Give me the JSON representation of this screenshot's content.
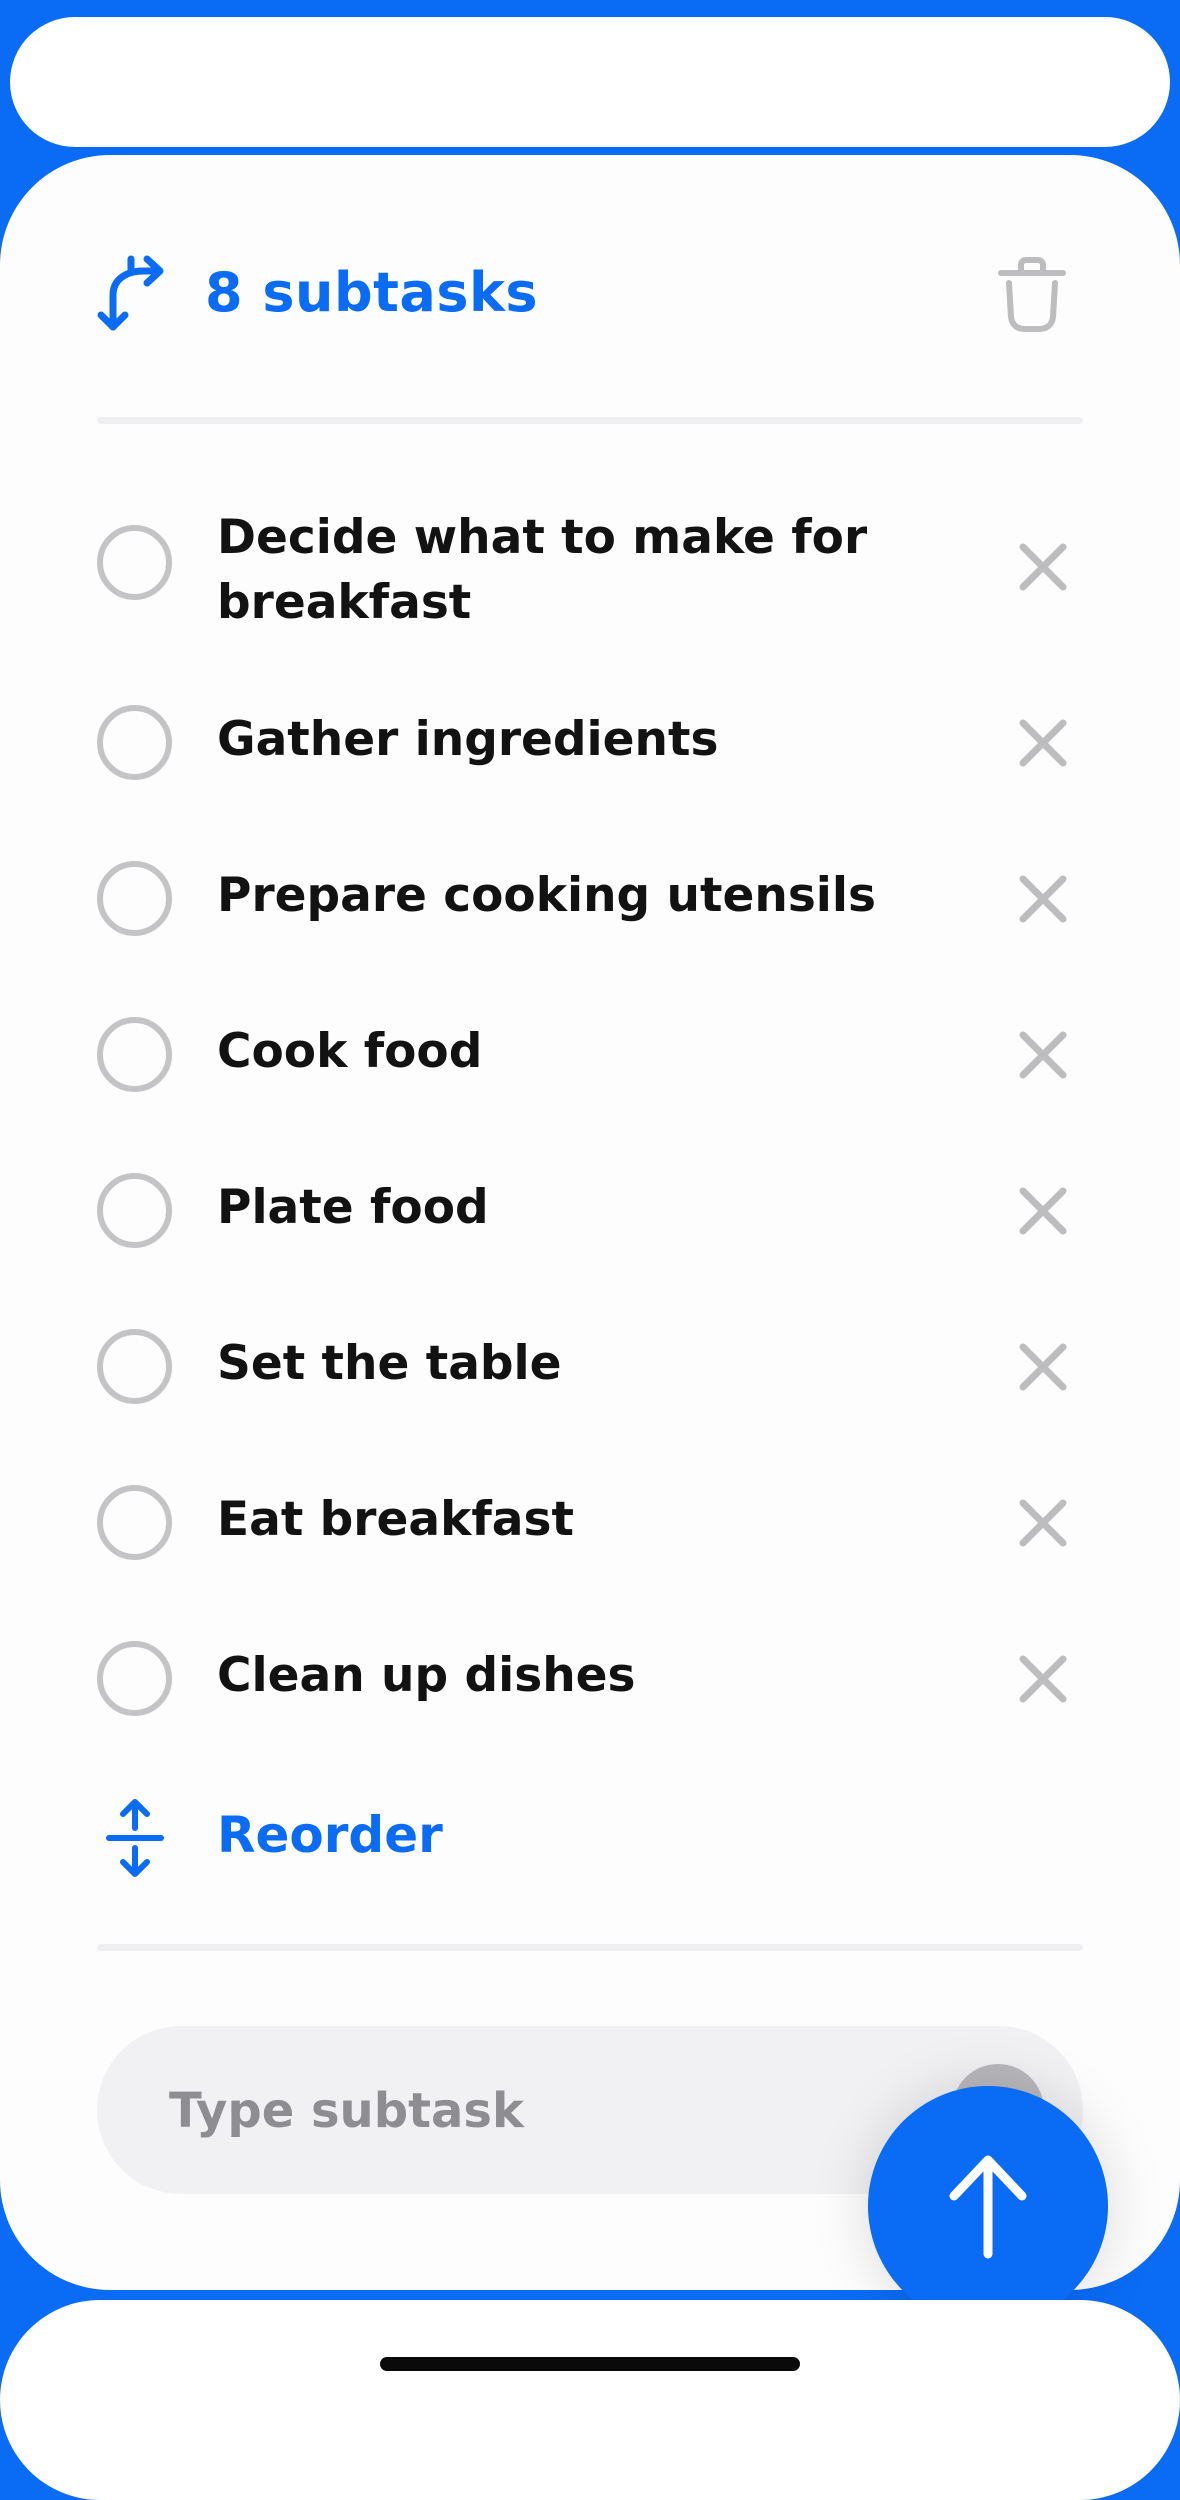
{
  "colors": {
    "accent": "#0a6bf5",
    "text": "#121212",
    "muted": "#c4c4c6",
    "placeholder": "#8e8e92"
  },
  "header": {
    "title": "8 subtasks",
    "leading_icon": "subtask-branch-icon",
    "trailing_icon": "trash-icon"
  },
  "subtasks": [
    {
      "label": "Decide what to make for breakfast",
      "completed": false
    },
    {
      "label": "Gather ingredients",
      "completed": false
    },
    {
      "label": "Prepare cooking utensils",
      "completed": false
    },
    {
      "label": "Cook food",
      "completed": false
    },
    {
      "label": "Plate food",
      "completed": false
    },
    {
      "label": "Set the table",
      "completed": false
    },
    {
      "label": "Eat breakfast",
      "completed": false
    },
    {
      "label": "Clean up dishes",
      "completed": false
    }
  ],
  "reorder": {
    "label": "Reorder",
    "icon": "reorder-arrows-icon"
  },
  "composer": {
    "placeholder": "Type subtask",
    "value": "",
    "send_icon": "arrow-up-icon"
  }
}
